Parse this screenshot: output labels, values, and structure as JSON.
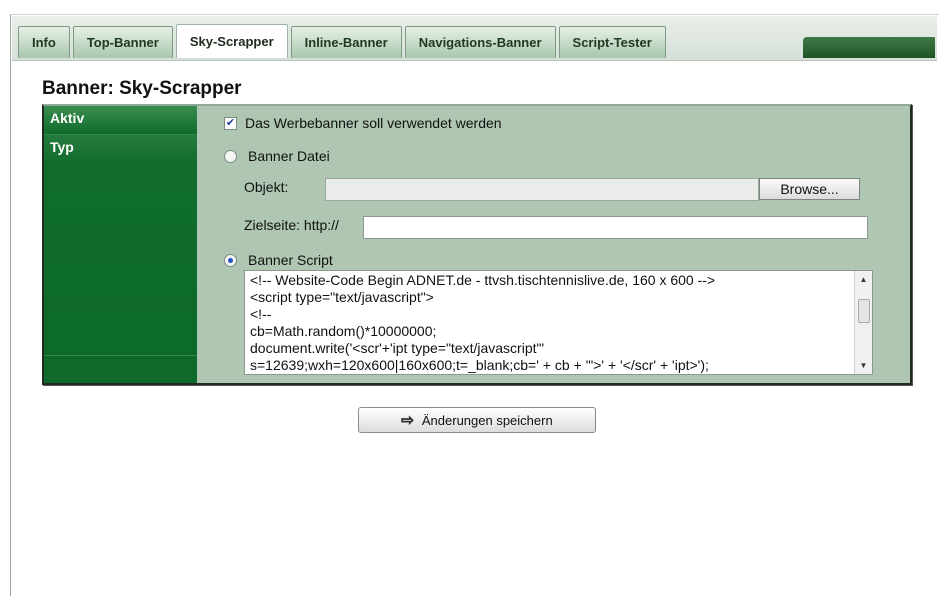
{
  "tabs": [
    {
      "label": "Info",
      "active": false
    },
    {
      "label": "Top-Banner",
      "active": false
    },
    {
      "label": "Sky-Scrapper",
      "active": true
    },
    {
      "label": "Inline-Banner",
      "active": false
    },
    {
      "label": "Navigations-Banner",
      "active": false
    },
    {
      "label": "Script-Tester",
      "active": false
    }
  ],
  "page_title": "Banner: Sky-Scrapper",
  "sidebar": {
    "aktiv": "Aktiv",
    "typ": "Typ"
  },
  "form": {
    "active_checkbox_label": "Das Werbebanner soll verwendet werden",
    "active_checked": true,
    "banner_datei_label": "Banner Datei",
    "banner_datei_selected": false,
    "objekt_label": "Objekt:",
    "objekt_value": "",
    "browse_label": "Browse...",
    "zielseite_label": "Zielseite: http://",
    "zielseite_value": "",
    "banner_script_label": "Banner Script",
    "banner_script_selected": true,
    "script_value": "<!-- Website-Code Begin ADNET.de - ttvsh.tischtennislive.de, 160 x 600 -->\n<script type=\"text/javascript\">\n<!--\ncb=Math.random()*10000000;\ndocument.write('<scr'+'ipt type=\"text/javascript\"'\ns=12639;wxh=120x600|160x600;t=_blank;cb=' + cb + '\">' + '</scr' + 'ipt>');"
  },
  "save_button": {
    "label": "Änderungen speichern",
    "icon": "arrow-right-icon"
  },
  "colors": {
    "sidebar_green": "#0e6a2a",
    "panel_bg": "#aec6b2",
    "tab_green": "#a9c6ad"
  }
}
